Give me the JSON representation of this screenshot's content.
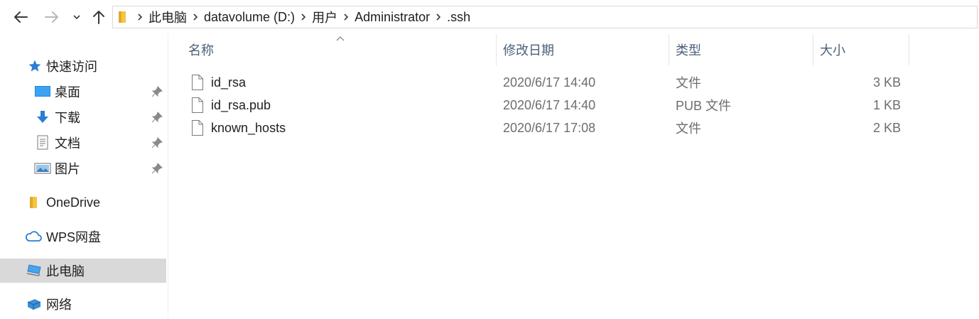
{
  "address_bar": {
    "breadcrumbs": [
      "此电脑",
      "datavolume (D:)",
      "用户",
      "Administrator",
      ".ssh"
    ]
  },
  "sidebar": {
    "quick_access": "快速访问",
    "pinned": [
      {
        "label": "桌面",
        "icon": "desktop-icon"
      },
      {
        "label": "下载",
        "icon": "download-icon"
      },
      {
        "label": "文档",
        "icon": "documents-icon"
      },
      {
        "label": "图片",
        "icon": "pictures-icon"
      }
    ],
    "onedrive": "OneDrive",
    "wps": "WPS网盘",
    "this_pc": "此电脑",
    "network": "网络",
    "selected": "此电脑"
  },
  "columns": {
    "name": "名称",
    "modified": "修改日期",
    "type": "类型",
    "size": "大小"
  },
  "files": [
    {
      "name": "id_rsa",
      "modified": "2020/6/17 14:40",
      "type": "文件",
      "size": "3 KB"
    },
    {
      "name": "id_rsa.pub",
      "modified": "2020/6/17 14:40",
      "type": "PUB 文件",
      "size": "1 KB"
    },
    {
      "name": "known_hosts",
      "modified": "2020/6/17 17:08",
      "type": "文件",
      "size": "2 KB"
    }
  ],
  "colors": {
    "folder": "#f4c542",
    "selection": "#d9d9d9",
    "header_text": "#4c607a",
    "accent": "#2b7cd3"
  }
}
